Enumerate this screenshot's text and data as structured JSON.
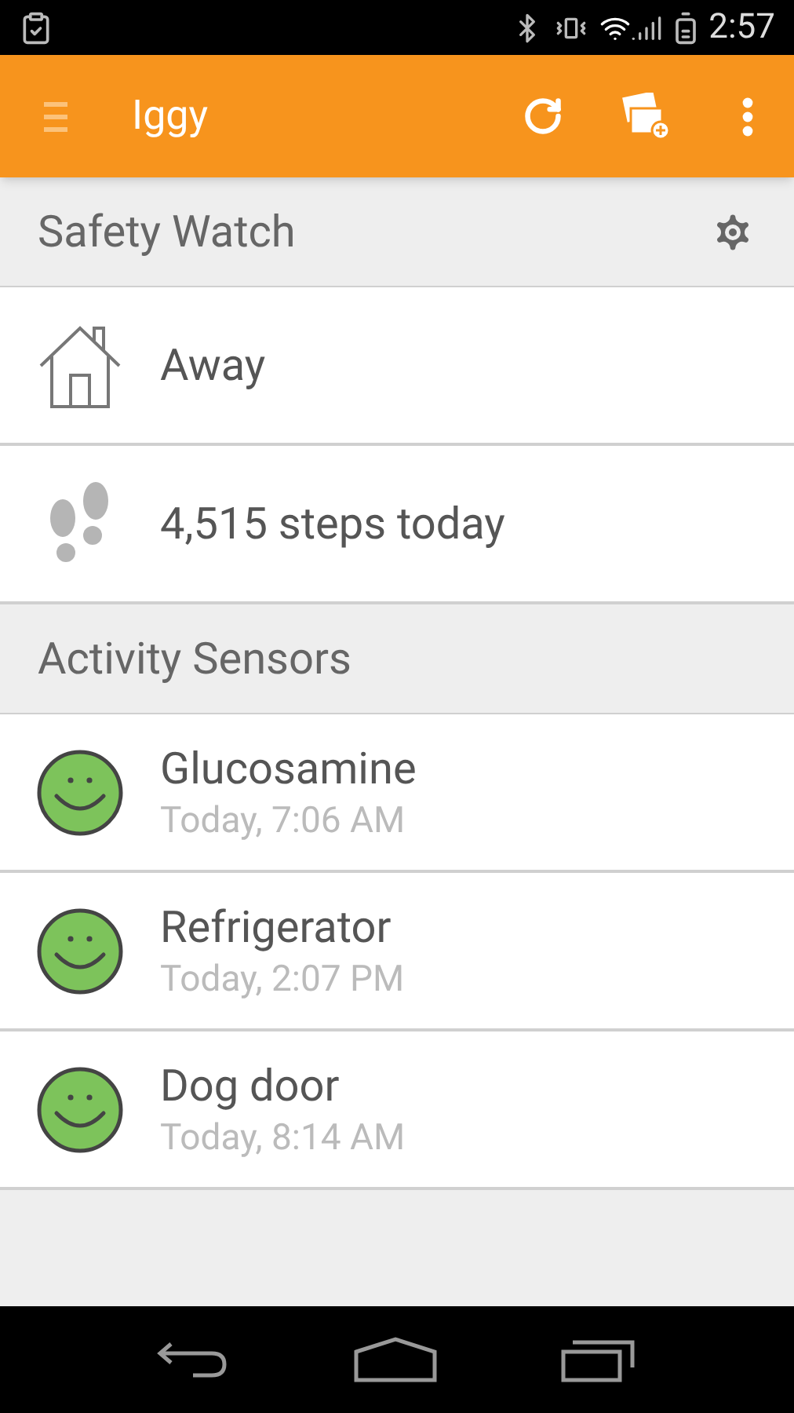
{
  "status_bar": {
    "time": "2:57"
  },
  "app_bar": {
    "title": "Iggy"
  },
  "safety_watch": {
    "title": "Safety Watch",
    "items": [
      {
        "kind": "home",
        "label": "Away"
      },
      {
        "kind": "steps",
        "label": "4,515 steps today"
      }
    ]
  },
  "activity_sensors": {
    "title": "Activity Sensors",
    "items": [
      {
        "name": "Glucosamine",
        "time": "Today, 7:06 AM"
      },
      {
        "name": "Refrigerator",
        "time": "Today, 2:07 PM"
      },
      {
        "name": "Dog door",
        "time": "Today, 8:14 AM"
      }
    ]
  }
}
